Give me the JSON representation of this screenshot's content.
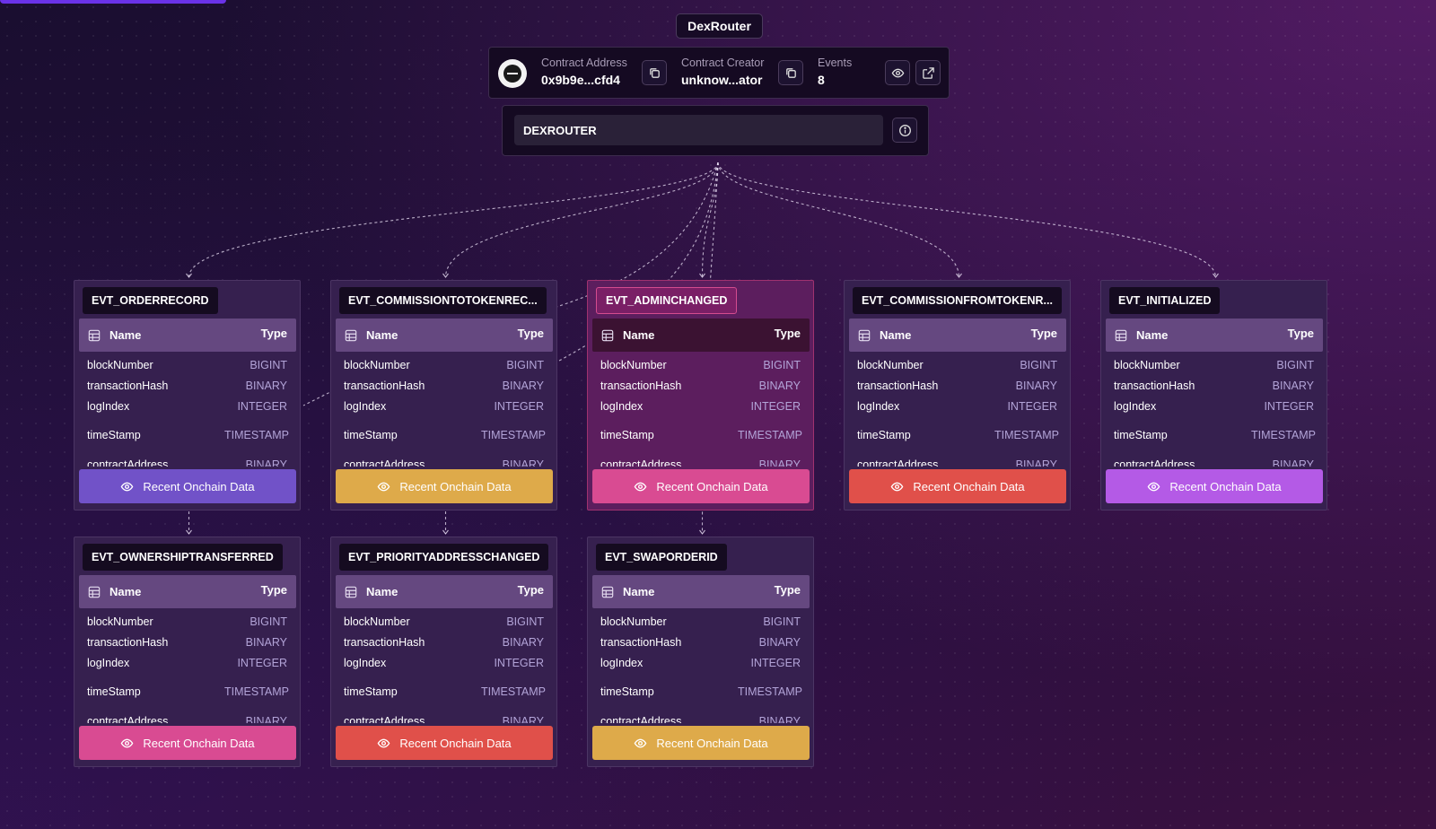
{
  "title": "DexRouter",
  "contract": {
    "address_label": "Contract Address",
    "address_value": "0x9b9e...cfd4",
    "creator_label": "Contract Creator",
    "creator_value": "unknow...ator",
    "events_label": "Events",
    "events_value": "8"
  },
  "search": {
    "value": "DEXROUTER"
  },
  "column_headers": {
    "name": "Name",
    "type": "Type"
  },
  "fields": [
    {
      "name": "blockNumber",
      "type": "BIGINT"
    },
    {
      "name": "transactionHash",
      "type": "BINARY"
    },
    {
      "name": "logIndex",
      "type": "INTEGER"
    },
    {
      "name": "timeStamp",
      "type": "TIMESTAMP"
    },
    {
      "name": "contractAddress",
      "type": "BINARY"
    }
  ],
  "events": [
    {
      "name": "EVT_ORDERRECORD",
      "button_label": "Recent Onchain Data",
      "button_color": "#7152c8",
      "highlighted": false
    },
    {
      "name": "EVT_COMMISSIONTOTOKENREC...",
      "button_label": "Recent Onchain Data",
      "button_color": "#deaa4a",
      "highlighted": false
    },
    {
      "name": "EVT_ADMINCHANGED",
      "button_label": "Recent Onchain Data",
      "button_color": "#d94b92",
      "highlighted": true
    },
    {
      "name": "EVT_COMMISSIONFROMTOKENR...",
      "button_label": "Recent Onchain Data",
      "button_color": "#e0504a",
      "highlighted": false
    },
    {
      "name": "EVT_INITIALIZED",
      "button_label": "Recent Onchain Data",
      "button_color": "#b45ae6",
      "highlighted": false
    },
    {
      "name": "EVT_OWNERSHIPTRANSFERRED",
      "button_label": "Recent Onchain Data",
      "button_color": "#d94b92",
      "highlighted": false
    },
    {
      "name": "EVT_PRIORITYADDRESSCHANGED",
      "button_label": "Recent Onchain Data",
      "button_color": "#e0504a",
      "highlighted": false
    },
    {
      "name": "EVT_SWAPORDERID",
      "button_label": "Recent Onchain Data",
      "button_color": "#deaa4a",
      "highlighted": false
    }
  ],
  "icons": {
    "copy": "copy-icon",
    "eye": "eye-icon",
    "external": "external-link-icon",
    "info": "info-icon",
    "table": "table-icon",
    "logo": "contract-logo-icon"
  }
}
